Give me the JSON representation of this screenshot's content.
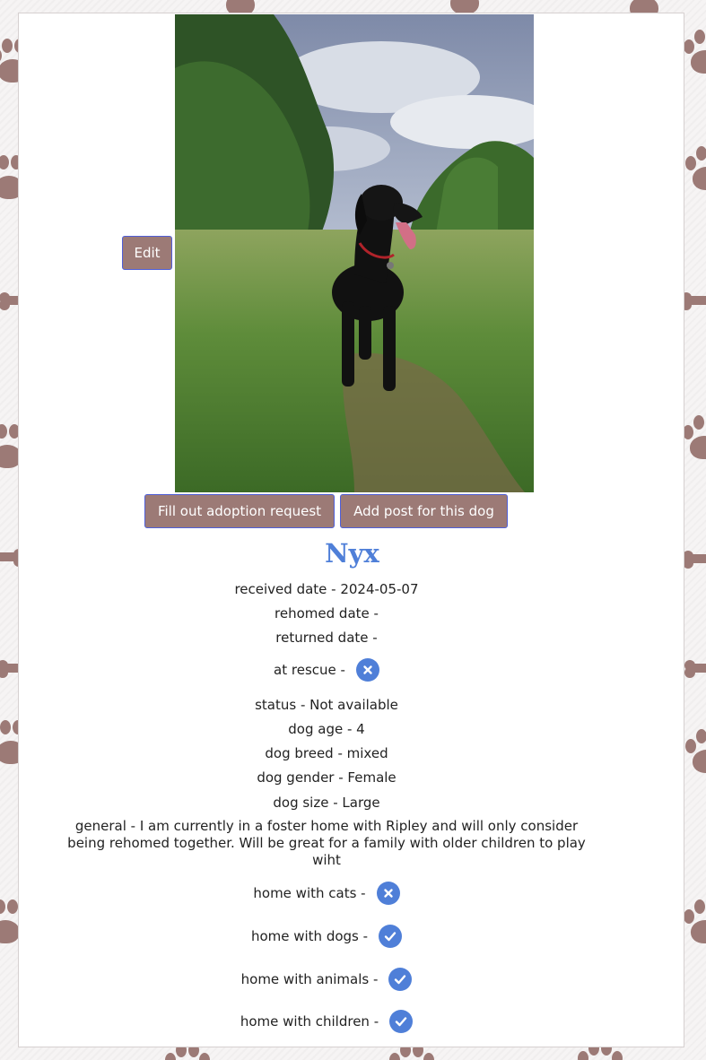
{
  "actions": {
    "edit_label": "Edit",
    "adopt_label": "Fill out adoption request",
    "post_label": "Add post for this dog"
  },
  "photo": {
    "alt": "Nyx"
  },
  "dog": {
    "name": "Nyx",
    "received": "received date - 2024-05-07",
    "rehomed": "rehomed date -",
    "returned": "returned date -",
    "at_rescue_label": "at rescue -",
    "at_rescue_icon": "cross-icon",
    "status": "status - Not available",
    "age": "dog age - 4",
    "breed": "dog breed - mixed",
    "gender": "dog gender - Female",
    "size": "dog size - Large",
    "general": "general - I am currently in a foster home with Ripley and will only consider being rehomed together. Will be great for a family with older children to play wiht",
    "cats_label": "home with cats -",
    "cats_icon": "cross-icon",
    "dogs_label": "home with dogs -",
    "dogs_icon": "check-icon",
    "animals_label": "home with animals -",
    "animals_icon": "check-icon",
    "children_label": "home with children -",
    "children_icon": "check-icon"
  },
  "colors": {
    "accent": "#4f7fd8",
    "button": "#9c7a76",
    "button_border": "#4f5fd8",
    "paw": "#9c7a76"
  }
}
